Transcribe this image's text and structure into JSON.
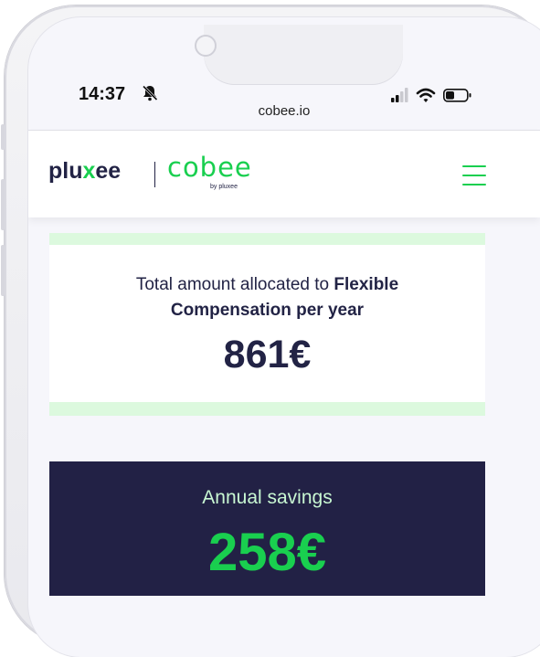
{
  "status_bar": {
    "time": "14:37",
    "icons": [
      "bell-slash-icon",
      "signal-icon",
      "wifi-icon",
      "battery-icon"
    ]
  },
  "browser": {
    "url": "cobee.io"
  },
  "header": {
    "logo_primary_a": "plu",
    "logo_primary_x": "x",
    "logo_primary_b": "ee",
    "logo_secondary": "cobee",
    "logo_secondary_tag": "by pluxee",
    "menu_icon": "hamburger-menu-icon"
  },
  "allocation": {
    "label_prefix": "Total amount allocated to ",
    "label_bold_1": "Flexible",
    "label_bold_2": "Compensation per year",
    "amount": "861€"
  },
  "savings": {
    "label": "Annual savings",
    "amount": "258€"
  },
  "colors": {
    "brand_green": "#19cf4f",
    "navy": "#222145",
    "light_green": "#dcf9de"
  }
}
